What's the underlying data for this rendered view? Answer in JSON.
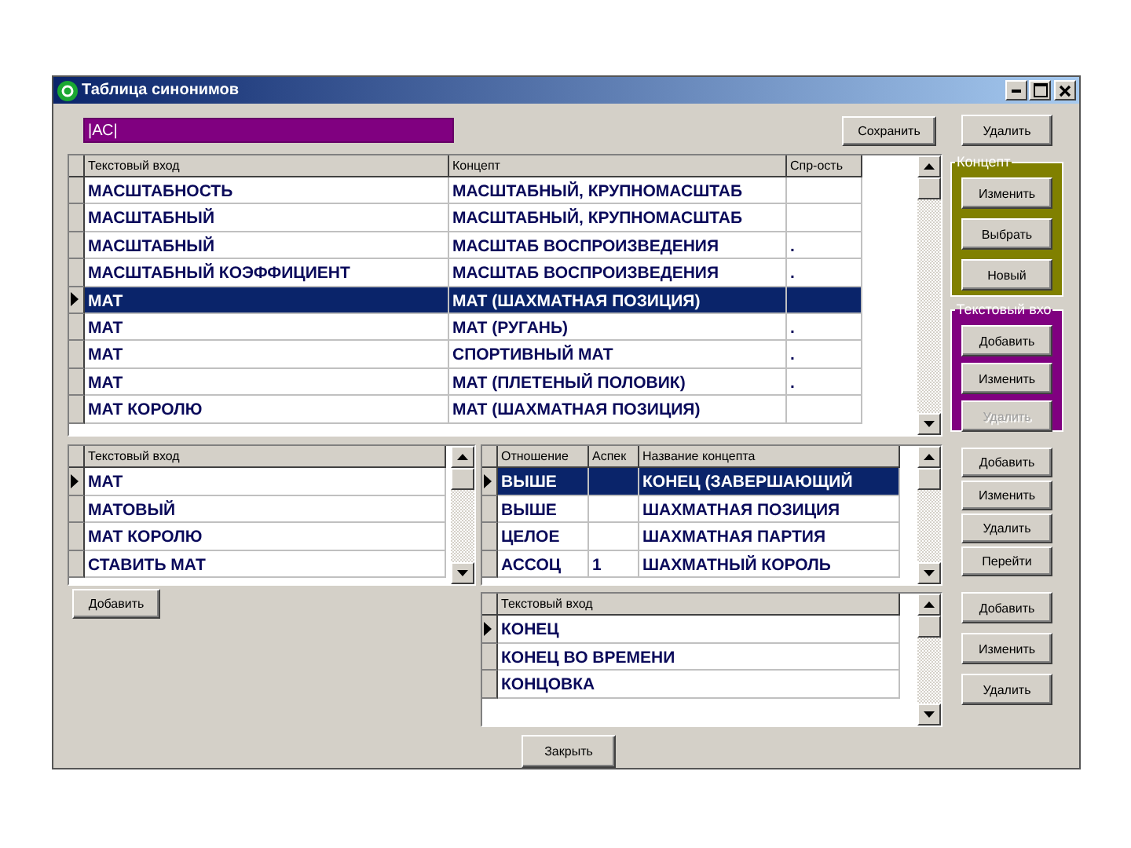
{
  "window": {
    "title": "Таблица синонимов"
  },
  "search": {
    "value": "|АС|"
  },
  "save_button": "Сохранить",
  "delete_button": "Удалить",
  "main_grid": {
    "columns": [
      "Текстовый вход",
      "Концепт",
      "Спр-ость"
    ],
    "rows": [
      {
        "cells": [
          "МАСШТАБНОСТЬ",
          "МАСШТАБНЫЙ, КРУПНОМАСШТАБ",
          ""
        ],
        "current": false,
        "selected": false
      },
      {
        "cells": [
          "МАСШТАБНЫЙ",
          "МАСШТАБНЫЙ, КРУПНОМАСШТАБ",
          ""
        ],
        "current": false,
        "selected": false
      },
      {
        "cells": [
          "МАСШТАБНЫЙ",
          "МАСШТАБ ВОСПРОИЗВЕДЕНИЯ",
          "."
        ],
        "current": false,
        "selected": false
      },
      {
        "cells": [
          "МАСШТАБНЫЙ КОЭФФИЦИЕНТ",
          "МАСШТАБ ВОСПРОИЗВЕДЕНИЯ",
          "."
        ],
        "current": false,
        "selected": false
      },
      {
        "cells": [
          "МАТ",
          "МАТ (ШАХМАТНАЯ ПОЗИЦИЯ)",
          ""
        ],
        "current": true,
        "selected": true
      },
      {
        "cells": [
          "МАТ",
          "МАТ (РУГАНЬ)",
          "."
        ],
        "current": false,
        "selected": false
      },
      {
        "cells": [
          "МАТ",
          "СПОРТИВНЫЙ МАТ",
          "."
        ],
        "current": false,
        "selected": false
      },
      {
        "cells": [
          "МАТ",
          "МАТ (ПЛЕТЕНЫЙ ПОЛОВИК)",
          "."
        ],
        "current": false,
        "selected": false
      },
      {
        "cells": [
          "МАТ КОРОЛЮ",
          "МАТ (ШАХМАТНАЯ ПОЗИЦИЯ)",
          ""
        ],
        "current": false,
        "selected": false
      }
    ]
  },
  "concept_group": {
    "title": "Концепт",
    "buttons": [
      {
        "label": "Изменить",
        "disabled": false
      },
      {
        "label": "Выбрать",
        "disabled": false
      },
      {
        "label": "Новый",
        "disabled": false
      }
    ]
  },
  "text_group": {
    "title": "Текстовый вхо",
    "buttons": [
      {
        "label": "Добавить",
        "disabled": false
      },
      {
        "label": "Изменить",
        "disabled": false
      },
      {
        "label": "Удалить",
        "disabled": true
      }
    ]
  },
  "entries_grid": {
    "columns": [
      "Текстовый вход"
    ],
    "rows": [
      {
        "cells": [
          "МАТ"
        ],
        "current": true,
        "selected": false
      },
      {
        "cells": [
          "МАТОВЫЙ"
        ],
        "current": false,
        "selected": false
      },
      {
        "cells": [
          "МАТ КОРОЛЮ"
        ],
        "current": false,
        "selected": false
      },
      {
        "cells": [
          "СТАВИТЬ МАТ"
        ],
        "current": false,
        "selected": false
      }
    ]
  },
  "add_entry_button": "Добавить",
  "relations_grid": {
    "columns": [
      "Отношение",
      "Аспек",
      "Название концепта"
    ],
    "rows": [
      {
        "cells": [
          "ВЫШЕ",
          "",
          "КОНЕЦ (ЗАВЕРШАЮЩИЙ"
        ],
        "current": true,
        "selected": true
      },
      {
        "cells": [
          "ВЫШЕ",
          "",
          "ШАХМАТНАЯ ПОЗИЦИЯ"
        ],
        "current": false,
        "selected": false
      },
      {
        "cells": [
          "ЦЕЛОЕ",
          "",
          "ШАХМАТНАЯ ПАРТИЯ"
        ],
        "current": false,
        "selected": false
      },
      {
        "cells": [
          "АССОЦ",
          "1",
          "ШАХМАТНЫЙ КОРОЛЬ"
        ],
        "current": false,
        "selected": false
      }
    ]
  },
  "relation_buttons": [
    "Добавить",
    "Изменить",
    "Удалить",
    "Перейти"
  ],
  "text_grid": {
    "columns": [
      "Текстовый вход"
    ],
    "rows": [
      {
        "cells": [
          "КОНЕЦ"
        ],
        "current": true,
        "selected": false
      },
      {
        "cells": [
          "КОНЕЦ ВО ВРЕМЕНИ"
        ],
        "current": false,
        "selected": false
      },
      {
        "cells": [
          "КОНЦОВКА"
        ],
        "current": false,
        "selected": false
      }
    ]
  },
  "text_buttons": [
    "Добавить",
    "Изменить",
    "Удалить"
  ],
  "close_button": "Закрыть"
}
